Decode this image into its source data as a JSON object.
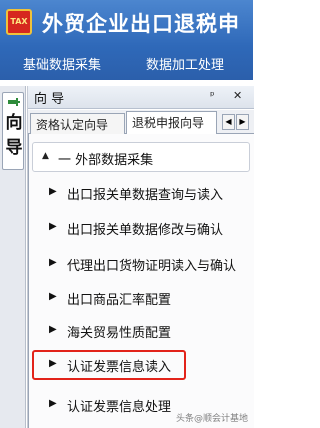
{
  "app": {
    "title": "外贸企业出口退税申",
    "icon_label": "TAX",
    "colors": {
      "title_bar": "#3a74c2",
      "highlight": "#e2231a"
    }
  },
  "menu": {
    "items": [
      "基础数据采集",
      "数据加工处理"
    ]
  },
  "dock": {
    "tab_label": "向导",
    "pin_icon": "pin-icon"
  },
  "panel": {
    "title": "向 导",
    "pin_glyph": "ᵖ",
    "close_glyph": "✕",
    "tabs": [
      "资格认定向导",
      "退税申报向导"
    ],
    "active_tab": "退税申报向导",
    "scroll_left": "◀",
    "scroll_right": "▶",
    "group": {
      "arrow": "▲",
      "label": "一 外部数据采集",
      "items": [
        {
          "arrow": "▶",
          "label": "出口报关单数据查询与读入"
        },
        {
          "arrow": "▶",
          "label": "出口报关单数据修改与确认"
        },
        {
          "arrow": "▶",
          "label": "代理出口货物证明读入与确认"
        },
        {
          "arrow": "▶",
          "label": "出口商品汇率配置"
        },
        {
          "arrow": "▶",
          "label": "海关贸易性质配置"
        },
        {
          "arrow": "▶",
          "label": "认证发票信息读入",
          "highlighted": true
        },
        {
          "arrow": "▶",
          "label": "认证发票信息处理"
        }
      ]
    }
  },
  "watermark": "头条@顺会计基地"
}
